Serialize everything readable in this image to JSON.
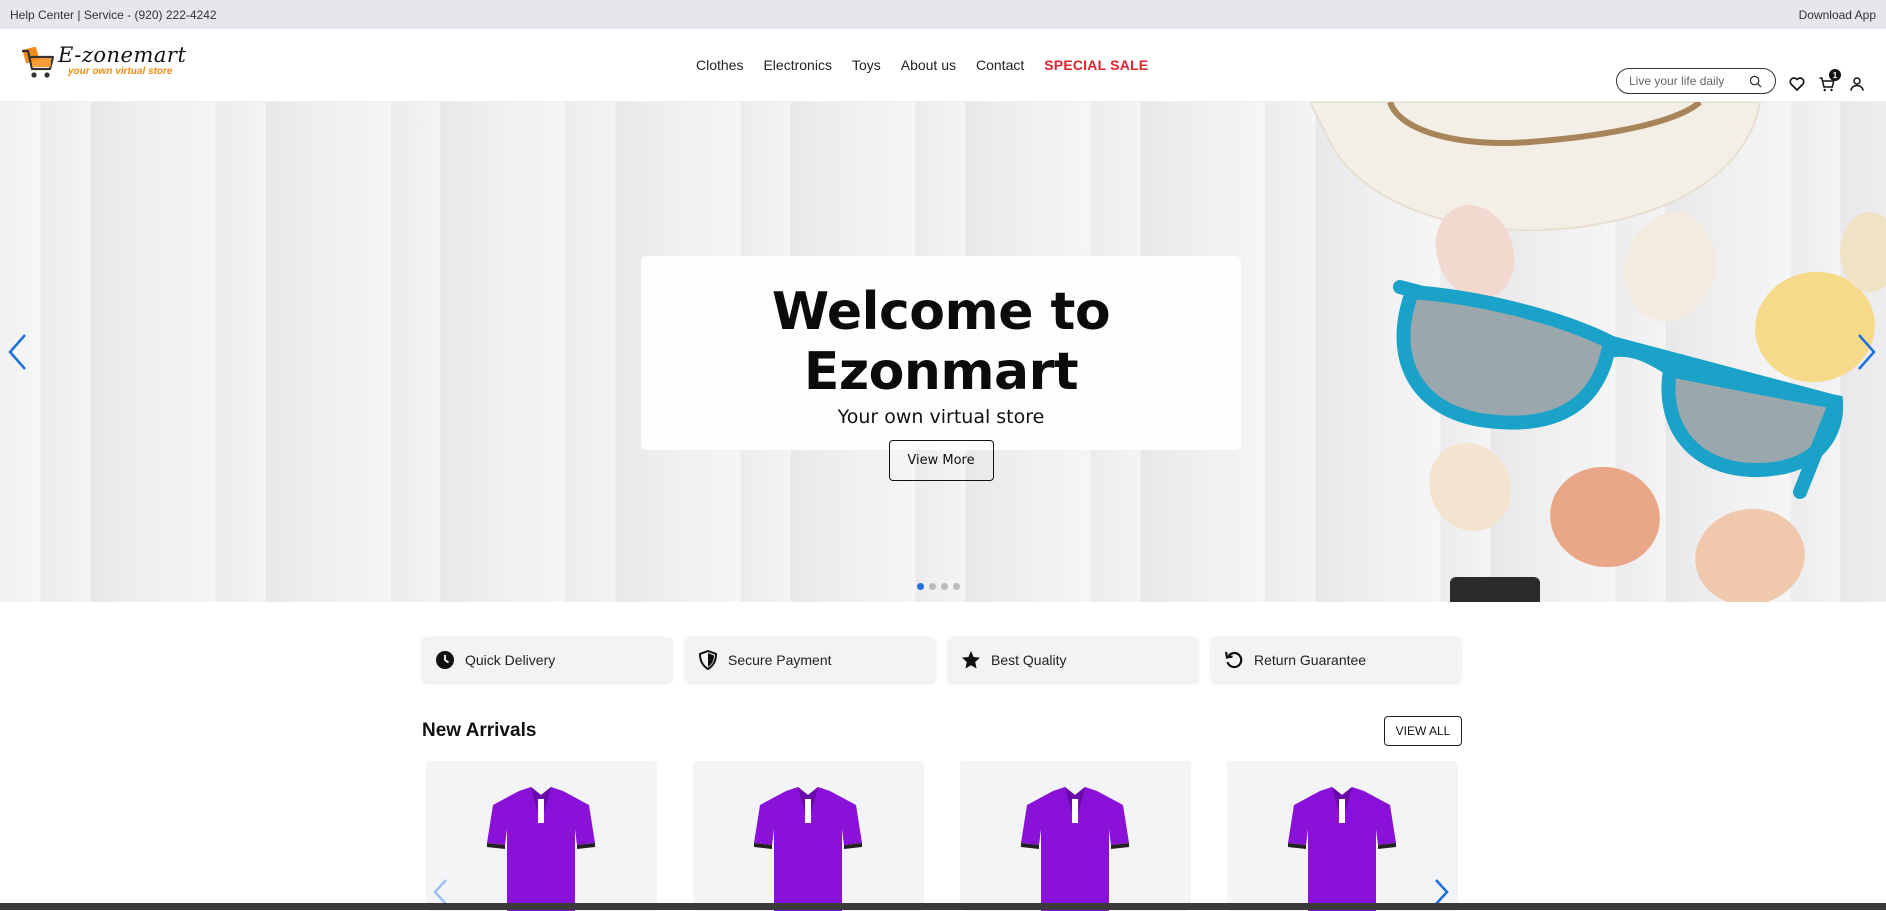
{
  "topbar": {
    "left_text": "Help Center | Service - (920) 222-4242",
    "right_text": "Download App"
  },
  "brand": {
    "name": "E-zonemart",
    "tagline": "your own virtual store",
    "accent_color": "#f28c18"
  },
  "nav": {
    "items": [
      "Clothes",
      "Electronics",
      "Toys",
      "About us",
      "Contact"
    ],
    "sale_label": "SPECIAL SALE",
    "sale_color": "#e0242f"
  },
  "search": {
    "placeholder": "Live your life daily",
    "icon": "search-icon"
  },
  "header_icons": {
    "wishlist": "heart-icon",
    "cart": "cart-icon",
    "cart_count": "1",
    "account": "user-icon"
  },
  "hero": {
    "title": "Welcome to Ezonmart",
    "subtitle": "Your own virtual store",
    "button_label": "View More",
    "slide_count": 4,
    "active_slide": 1,
    "arrow_color": "#1e6fe0"
  },
  "features": [
    {
      "label": "Quick Delivery",
      "icon": "clock-icon"
    },
    {
      "label": "Secure Payment",
      "icon": "shield-icon"
    },
    {
      "label": "Best Quality",
      "icon": "star-icon"
    },
    {
      "label": "Return Guarantee",
      "icon": "return-icon"
    }
  ],
  "new_arrivals": {
    "title": "New Arrivals",
    "view_all_label": "VIEW ALL",
    "products": [
      {
        "image": "purple-polo-shirt"
      },
      {
        "image": "purple-polo-shirt"
      },
      {
        "image": "purple-polo-shirt"
      },
      {
        "image": "purple-polo-shirt"
      }
    ],
    "shirt_color": "#8a12d8"
  }
}
